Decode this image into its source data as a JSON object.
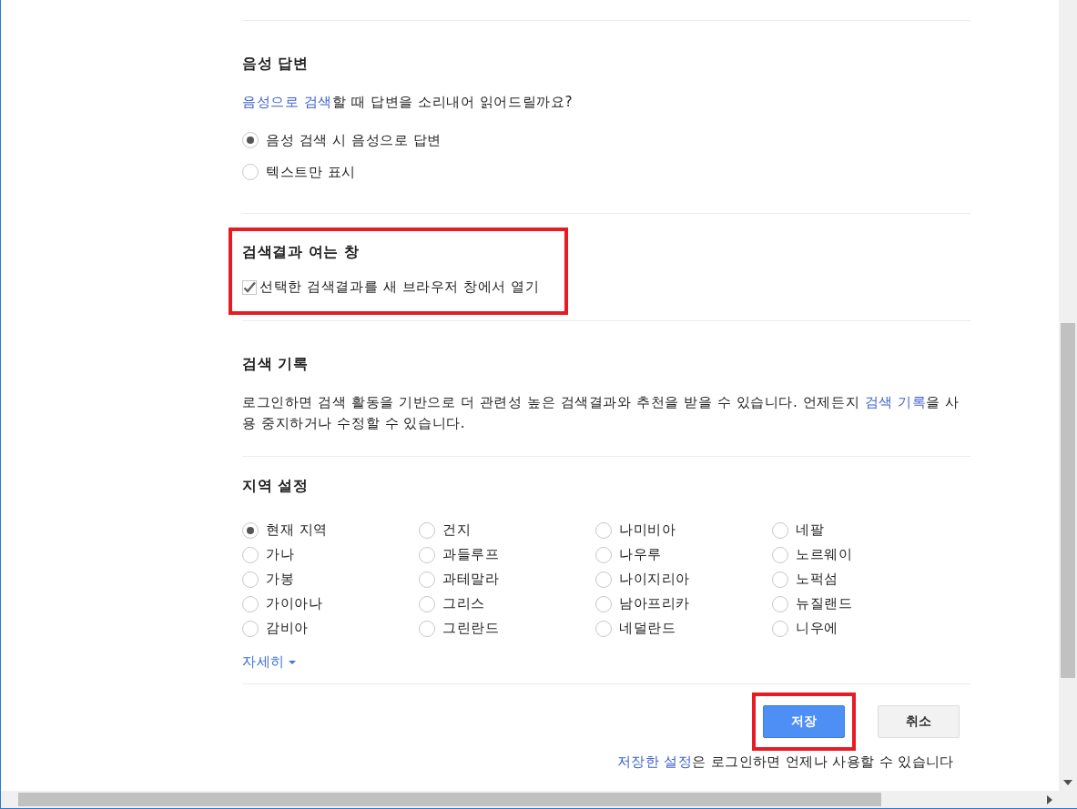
{
  "voice_answer": {
    "heading": "음성 답변",
    "question": [
      {
        "text": "음성으로 검색",
        "link": true
      },
      {
        "text": "할 때 답변을 소리내어 읽어드릴까요?",
        "link": false
      }
    ],
    "options": [
      {
        "label": "음성 검색 시 음성으로 답변",
        "selected": true
      },
      {
        "label": "텍스트만 표시",
        "selected": false
      }
    ]
  },
  "results_window": {
    "heading": "검색결과 여는 창",
    "highlighted": true,
    "checkbox": {
      "label": "선택한 검색결과를 새 브라우저 창에서 열기",
      "checked": true
    }
  },
  "search_history": {
    "heading": "검색 기록",
    "paragraph": [
      {
        "text": "로그인하면 검색 활동을 기반으로 더 관련성 높은 검색결과와 추천을 받을 수 있습니다. 언제든지 ",
        "link": false
      },
      {
        "text": "검색 기록",
        "link": true
      },
      {
        "text": "을 사용 중지하거나 수정할 수 있습니다.",
        "link": false
      }
    ]
  },
  "region": {
    "heading": "지역 설정",
    "columns": [
      [
        {
          "label": "현재 지역",
          "selected": true
        },
        {
          "label": "가나",
          "selected": false
        },
        {
          "label": "가봉",
          "selected": false
        },
        {
          "label": "가이아나",
          "selected": false
        },
        {
          "label": "감비아",
          "selected": false
        }
      ],
      [
        {
          "label": "건지",
          "selected": false
        },
        {
          "label": "과들루프",
          "selected": false
        },
        {
          "label": "과테말라",
          "selected": false
        },
        {
          "label": "그리스",
          "selected": false
        },
        {
          "label": "그린란드",
          "selected": false
        }
      ],
      [
        {
          "label": "나미비아",
          "selected": false
        },
        {
          "label": "나우루",
          "selected": false
        },
        {
          "label": "나이지리아",
          "selected": false
        },
        {
          "label": "남아프리카",
          "selected": false
        },
        {
          "label": "네덜란드",
          "selected": false
        }
      ],
      [
        {
          "label": "네팔",
          "selected": false
        },
        {
          "label": "노르웨이",
          "selected": false
        },
        {
          "label": "노퍽섬",
          "selected": false
        },
        {
          "label": "뉴질랜드",
          "selected": false
        },
        {
          "label": "니우에",
          "selected": false
        }
      ]
    ],
    "more_link": "자세히"
  },
  "buttons": [
    {
      "label": "저장",
      "kind": "primary",
      "highlighted": true
    },
    {
      "label": "취소",
      "kind": "secondary",
      "highlighted": false
    }
  ],
  "footer_note": [
    {
      "text": "저장한 설정",
      "link": true
    },
    {
      "text": "은 로그인하면 언제나 사용할 수 있습니다",
      "link": false
    }
  ]
}
